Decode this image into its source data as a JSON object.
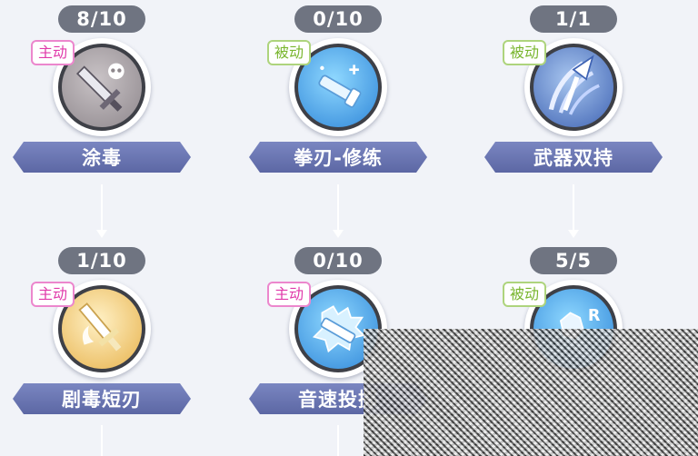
{
  "skill_tree": {
    "nodes": [
      {
        "level": "8/10",
        "tag": "主动",
        "tag_type": "active",
        "name": "涂毒",
        "icon": "poison-sword-icon"
      },
      {
        "level": "0/10",
        "tag": "被动",
        "tag_type": "passive",
        "name": "拳刃-修练",
        "icon": "fist-blade-icon"
      },
      {
        "level": "1/1",
        "tag": "被动",
        "tag_type": "passive",
        "name": "武器双持",
        "icon": "dual-weapon-icon"
      },
      {
        "level": "1/10",
        "tag": "主动",
        "tag_type": "active",
        "name": "剧毒短刃",
        "icon": "toxic-dagger-icon"
      },
      {
        "level": "0/10",
        "tag": "主动",
        "tag_type": "active",
        "name": "音速投掷",
        "icon": "sonic-throw-icon"
      },
      {
        "level": "5/5",
        "tag": "被动",
        "tag_type": "passive",
        "name": "",
        "icon": "r-skill-icon"
      }
    ]
  },
  "colors": {
    "background": "#f1f3f8",
    "level_pill": "#6f7481",
    "banner": "#6b76b3",
    "active_tag": "#e03aaa",
    "passive_tag": "#79b62f"
  }
}
